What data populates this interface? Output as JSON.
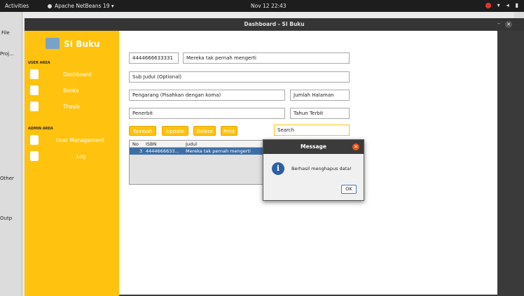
{
  "topbar": {
    "activities": "Activities",
    "app_name": "Apache NetBeans 19",
    "app_menu_arrow": "▾",
    "clock": "Nov 12  22:43"
  },
  "ide": {
    "file_menu": "File",
    "projects_tab": "Proj...",
    "other_label": "Other",
    "output_label": "Outp"
  },
  "window": {
    "title": "Dashboard - SI Buku",
    "minimize": "–",
    "close": "✕"
  },
  "sidebar": {
    "logo_text": "SI Buku",
    "user_area": "USER AREA",
    "admin_area": "ADMIN AREA",
    "user_items": [
      {
        "label": "Dashboard",
        "icon": "home-icon"
      },
      {
        "label": "Books",
        "icon": "books-icon"
      },
      {
        "label": "Thesis",
        "icon": "thesis-icon"
      }
    ],
    "admin_items": [
      {
        "label": "User Management",
        "icon": "user-icon"
      },
      {
        "label": "Log",
        "icon": "log-icon"
      }
    ],
    "accent": "#ffc20e"
  },
  "form": {
    "isbn": "4444666633331",
    "judul": "Mereka tak pernah mengerti",
    "sub_judul": "Sub Judul (Optional)",
    "pengarang": "Pengarang (Pisahkan dengan koma)",
    "jumlah_halaman": "Jumlah Halaman",
    "penerbit": "Penerbit",
    "tahun_terbit": "Tahun Terbit",
    "search": "Search"
  },
  "buttons": {
    "tambah": "Tambah",
    "update": "Update",
    "delete": "Delete",
    "print": "Print"
  },
  "table": {
    "headers": [
      "No",
      "ISBN",
      "Judul",
      "P"
    ],
    "rows": [
      [
        "3",
        "4444666633...",
        "Mereka tak pernah mengerti",
        "C"
      ]
    ]
  },
  "message": {
    "title": "Message",
    "text": "Berhasil menghapus data!",
    "ok": "OK",
    "close": "✕",
    "info_glyph": "i"
  }
}
